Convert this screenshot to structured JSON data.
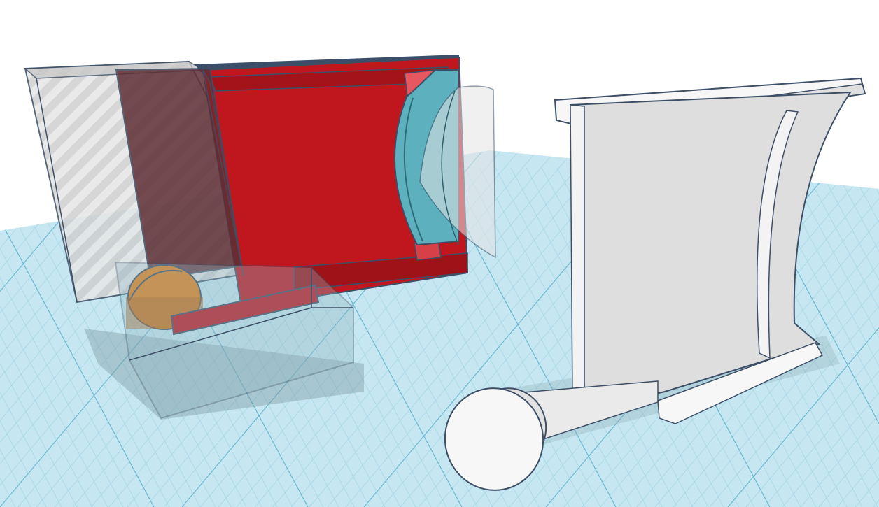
{
  "viewport": {
    "background": "#ffffff",
    "workplane_color": "#c6e7f1",
    "grid_minor_color": "#9dd2e3",
    "grid_major_color": "#6cb8d2"
  },
  "objects": [
    {
      "id": "hole-box-back",
      "kind": "hole",
      "color": "#d8d8d8"
    },
    {
      "id": "red-body",
      "kind": "solid",
      "color": "#c0171f"
    },
    {
      "id": "teal-lens",
      "kind": "solid",
      "color": "#5db1be"
    },
    {
      "id": "hole-cylinder-right",
      "kind": "hole",
      "color": "#e5e5e5"
    },
    {
      "id": "orange-cylinder",
      "kind": "solid",
      "color": "#e0821e"
    },
    {
      "id": "hole-box-front",
      "kind": "hole",
      "color": "#d0d8dc"
    },
    {
      "id": "white-part",
      "kind": "solid",
      "color": "#f0f0f0"
    },
    {
      "id": "white-wheel",
      "kind": "solid",
      "color": "#f7f7f7"
    }
  ]
}
